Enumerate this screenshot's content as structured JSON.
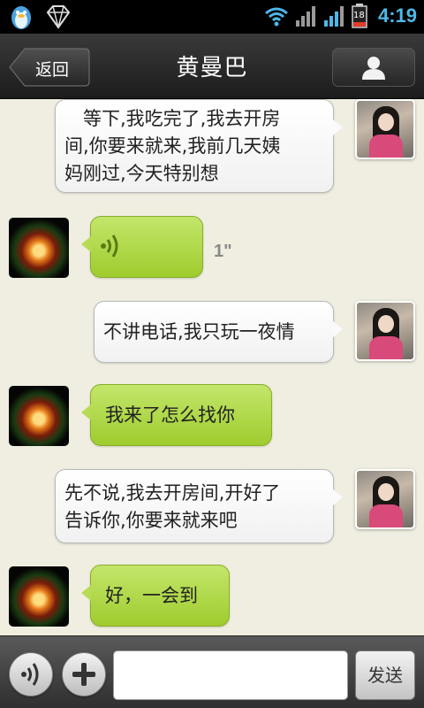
{
  "status_bar": {
    "time": "4:19",
    "battery_level": "18",
    "icons": [
      "qq-penguin-icon",
      "diamond-icon",
      "wifi-icon",
      "signal-icon",
      "signal-icon",
      "battery-icon"
    ]
  },
  "header": {
    "back_label": "返回",
    "title": "黄曼巴",
    "profile_icon": "person-icon"
  },
  "messages": [
    {
      "side": "right",
      "type": "text",
      "text_lines": [
        "　等下,我吃完了,我去开房",
        "间,你要来就来,我前几天姨",
        "妈刚过,今天特别想"
      ]
    },
    {
      "side": "left",
      "type": "voice",
      "duration": "1\"",
      "icon": "voice-wave-icon"
    },
    {
      "side": "right",
      "type": "text",
      "text_lines": [
        "不讲电话,我只玩一夜情"
      ]
    },
    {
      "side": "left",
      "type": "text",
      "text_lines": [
        "我来了怎么找你"
      ]
    },
    {
      "side": "right",
      "type": "text",
      "text_lines": [
        "先不说,我去开房间,开好了",
        "告诉你,你要来就来吧"
      ]
    },
    {
      "side": "left",
      "type": "text",
      "text_lines": [
        "好，一会到"
      ]
    }
  ],
  "input_bar": {
    "voice_icon": "voice-wave-icon",
    "plus_icon": "plus-icon",
    "input_value": "",
    "send_label": "发送"
  },
  "colors": {
    "chat_background": "#efeee0",
    "green_bubble": "#b6dc55",
    "clock_blue": "#4fb8e8"
  }
}
